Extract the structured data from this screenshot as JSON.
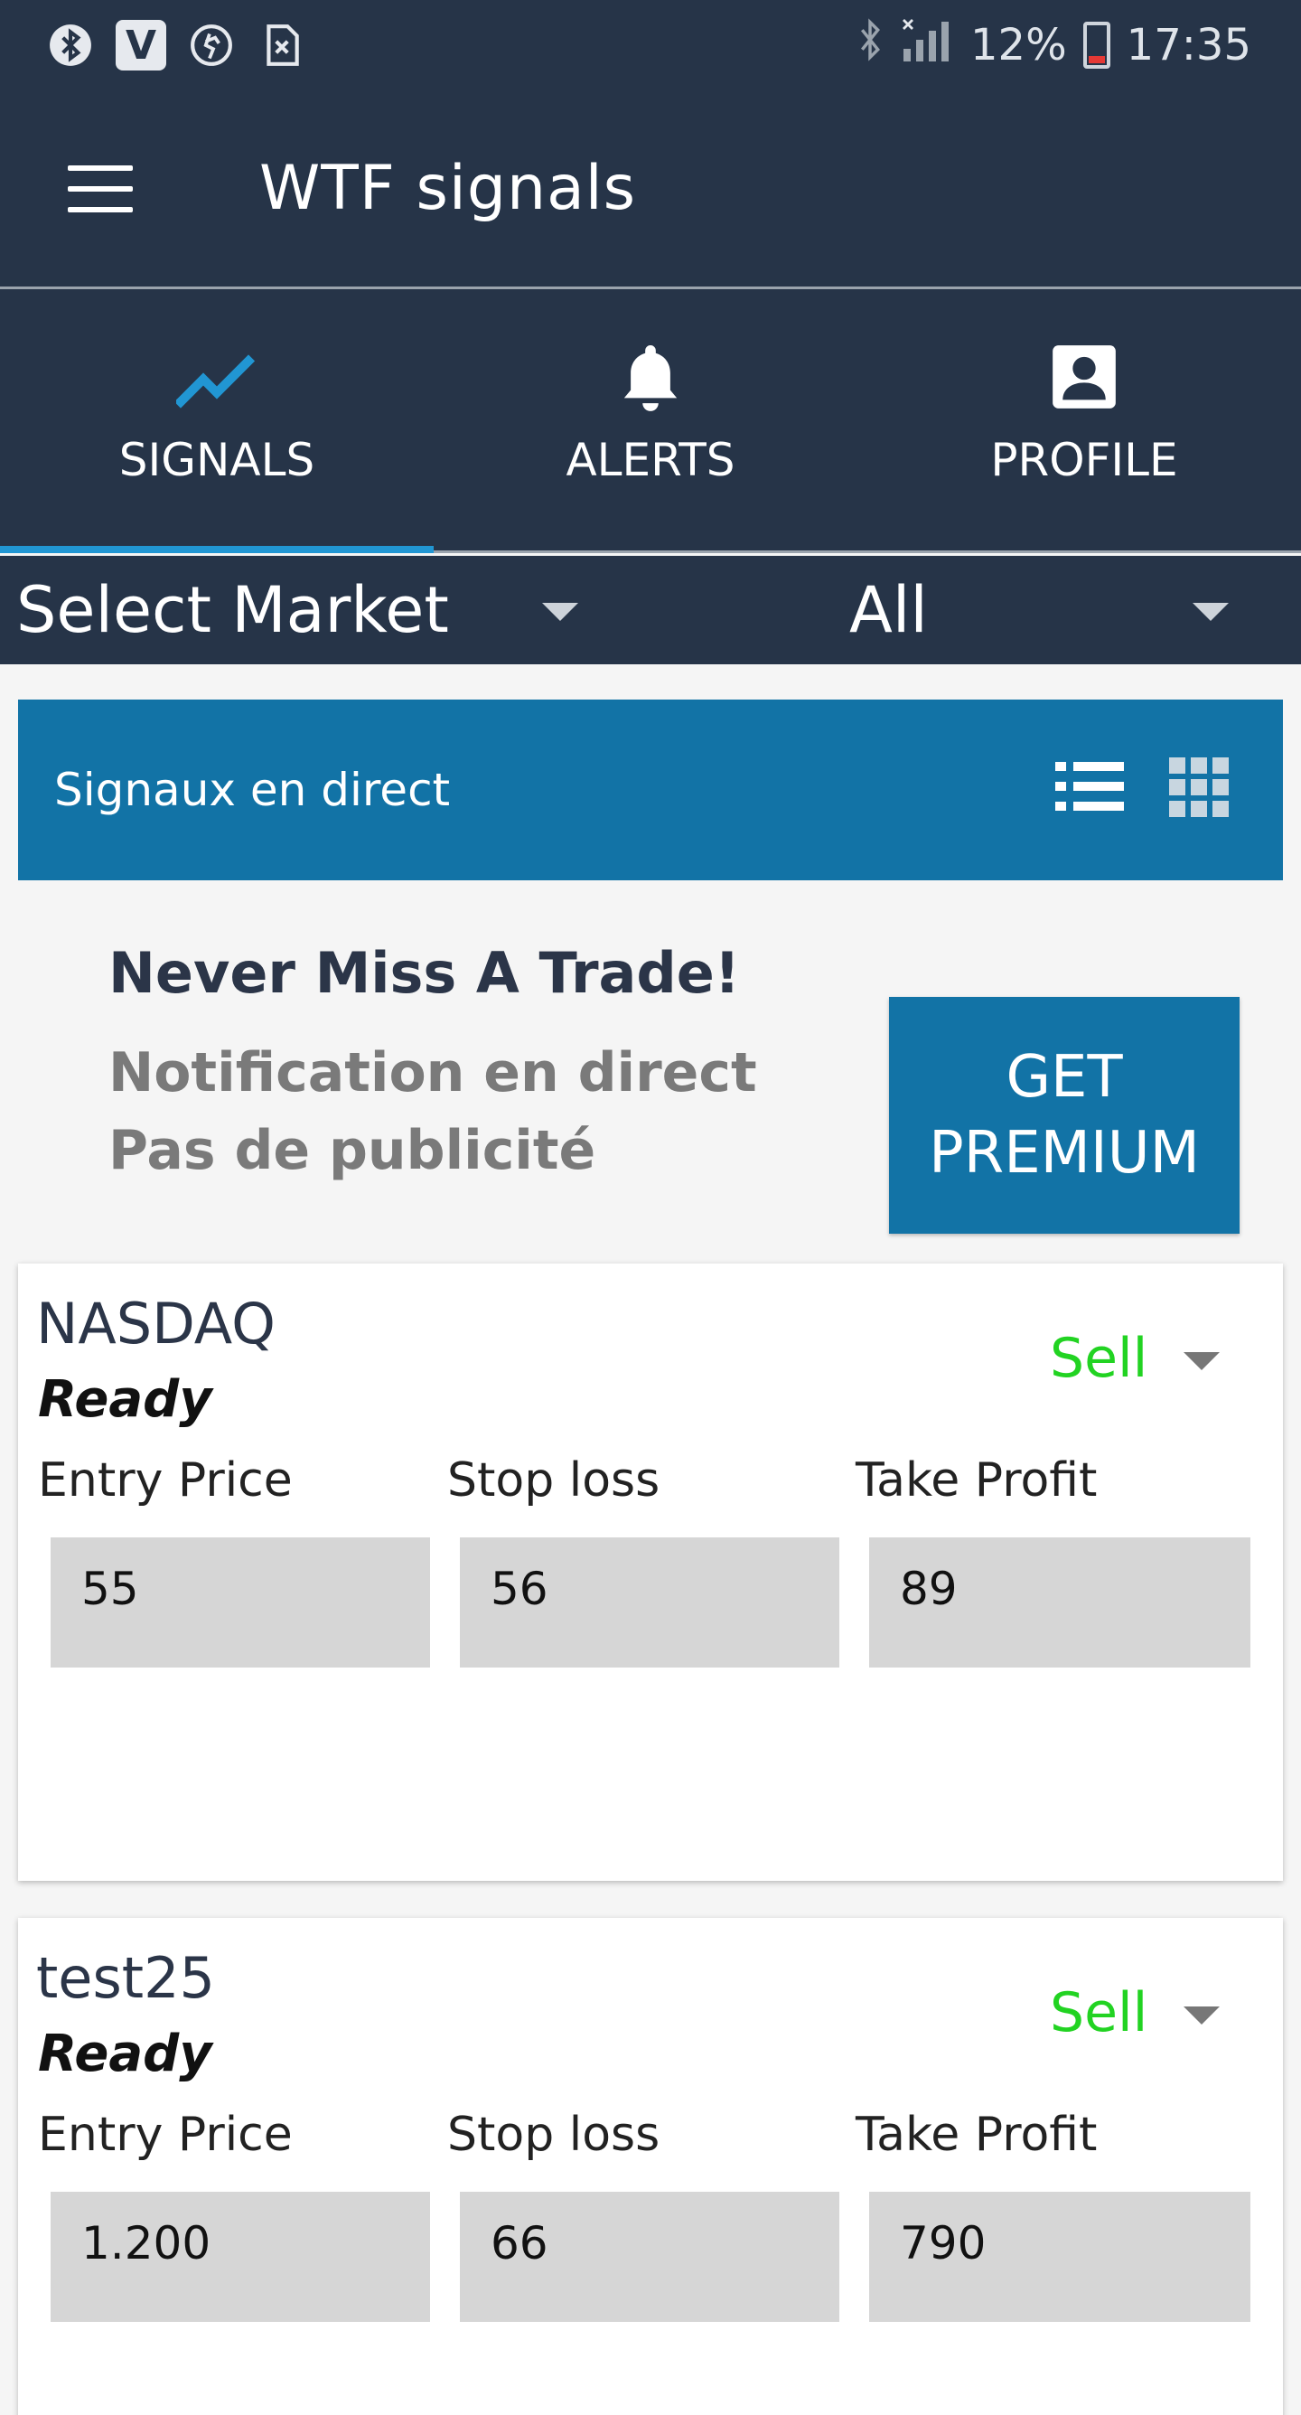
{
  "status_bar": {
    "battery": "12%",
    "time": "17:35",
    "left_icons": [
      "bluetooth-icon",
      "viber-icon",
      "activity-icon",
      "sim-missing-icon"
    ]
  },
  "app_bar": {
    "title": "WTF signals"
  },
  "tabs": [
    {
      "label": "SIGNALS",
      "icon": "trending-up-icon",
      "active": true
    },
    {
      "label": "ALERTS",
      "icon": "bell-icon",
      "active": false
    },
    {
      "label": "PROFILE",
      "icon": "profile-icon",
      "active": false
    }
  ],
  "filters": {
    "market": "Select Market",
    "type": "All"
  },
  "live_header": {
    "title": "Signaux en direct"
  },
  "promo": {
    "title": "Never Miss A Trade!",
    "line1": "Notification en direct",
    "line2": "Pas de publicité",
    "button_line1": "GET",
    "button_line2": "PREMIUM"
  },
  "cards": [
    {
      "market": "NASDAQ",
      "state": "Ready",
      "action": "Sell",
      "entry_label": "Entry Price",
      "stop_label": "Stop loss",
      "take_label": "Take Profit",
      "entry": "55",
      "stop": "56",
      "take": "89"
    },
    {
      "market": "test25",
      "state": "Ready",
      "action": "Sell",
      "entry_label": "Entry Price",
      "stop_label": "Stop loss",
      "take_label": "Take Profit",
      "entry": "1.200",
      "stop": "66",
      "take": "790"
    }
  ],
  "colors": {
    "header_bg": "#263448",
    "accent_blue": "#1273a6",
    "active_tab_indicator": "#2196d3",
    "sell_green": "#22d322"
  }
}
